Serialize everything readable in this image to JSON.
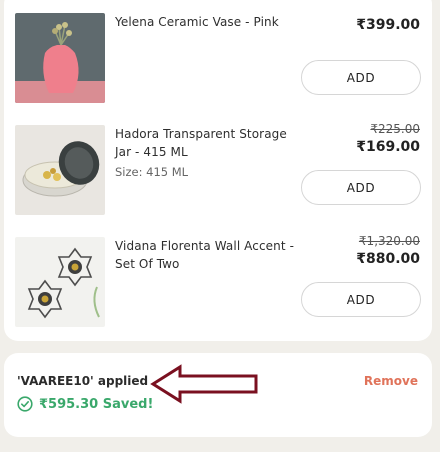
{
  "cart": {
    "items": [
      {
        "name": "Yelena Ceramic Vase - Pink",
        "size": "",
        "old_price": "",
        "price": "₹399.00",
        "button": "ADD"
      },
      {
        "name": "Hadora Transparent Storage Jar - 415 ML",
        "size": "Size: 415 ML",
        "old_price": "₹225.00",
        "price": "₹169.00",
        "button": "ADD"
      },
      {
        "name": "Vidana Florenta Wall Accent - Set Of Two",
        "size": "",
        "old_price": "₹1,320.00",
        "price": "₹880.00",
        "button": "ADD"
      }
    ]
  },
  "coupon": {
    "applied_text": "'VAAREE10' applied",
    "remove_label": "Remove",
    "saved_text": "₹595.30 Saved!",
    "saved_color": "#3aa86b",
    "remove_color": "#e0735a",
    "icon": "check-circle-icon"
  },
  "annotation": {
    "arrow_color": "#7a1020",
    "icon": "left-arrow-annotation"
  }
}
